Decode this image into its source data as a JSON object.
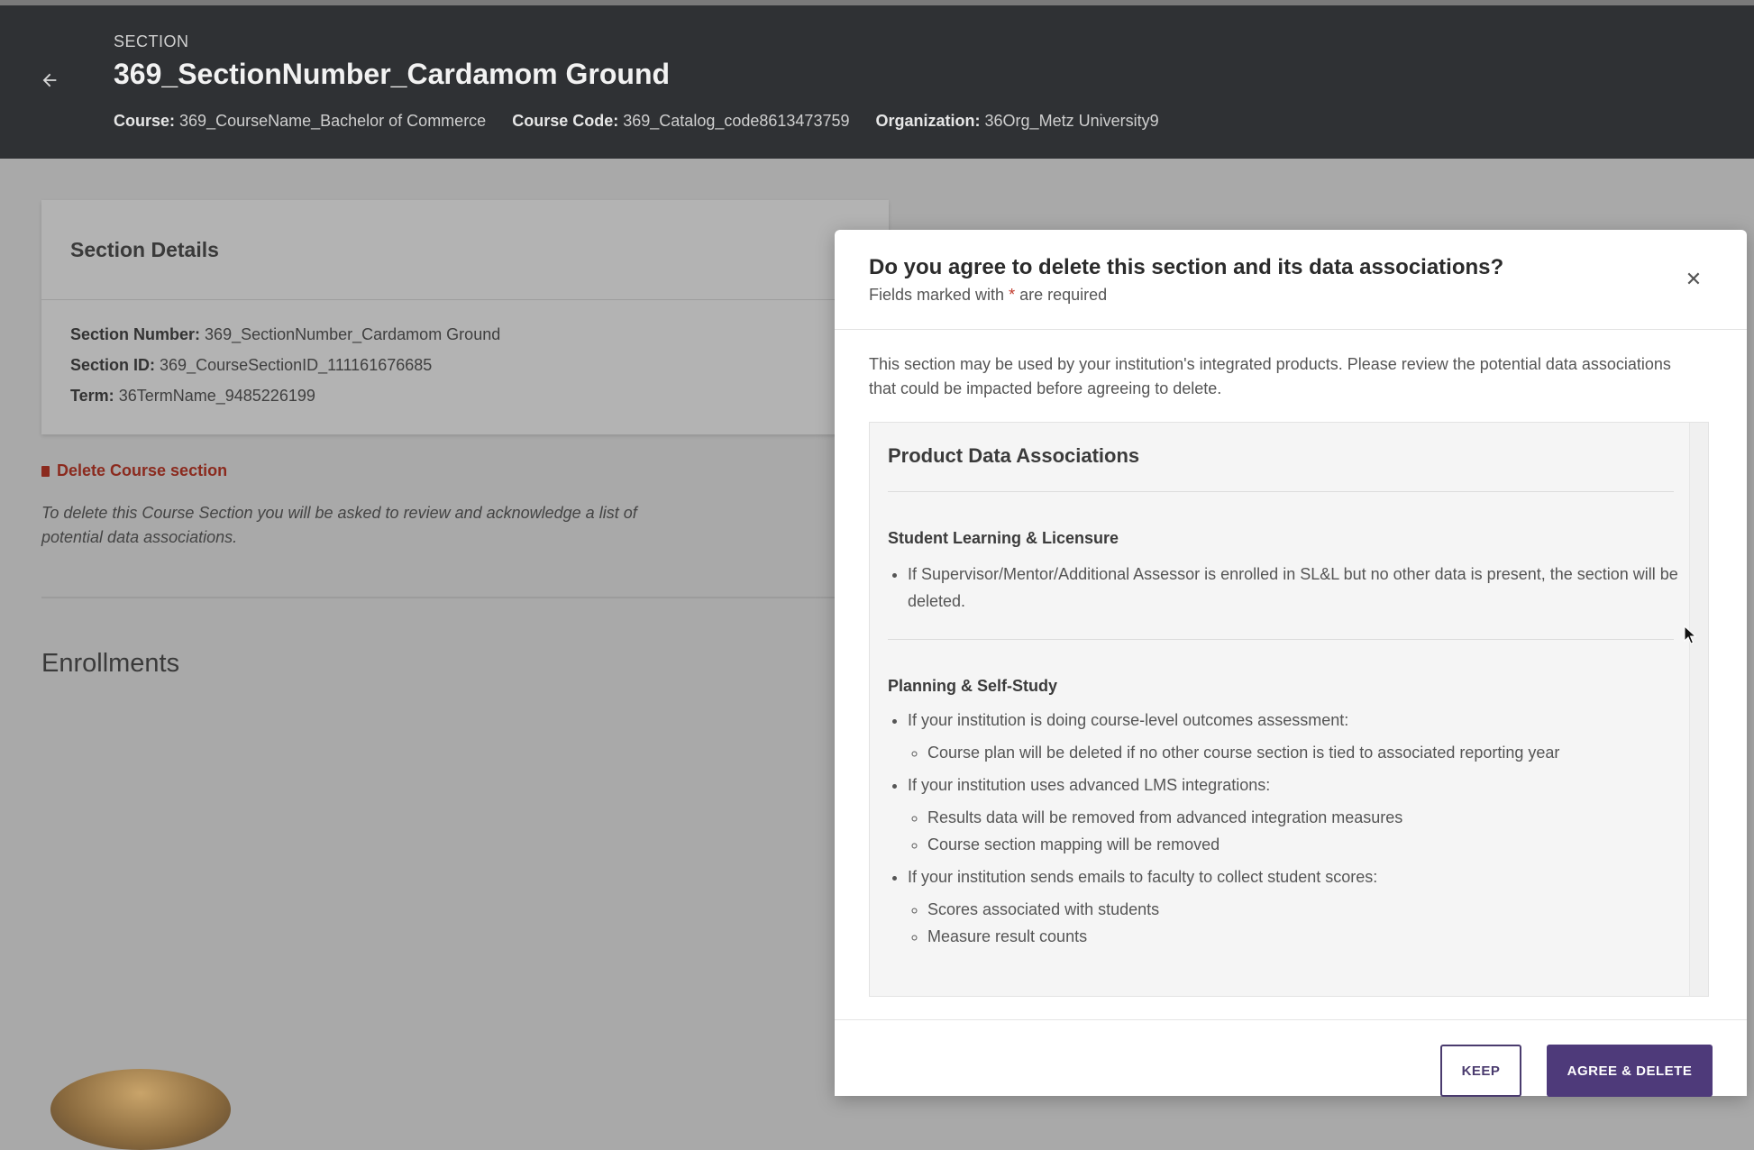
{
  "header": {
    "eyebrow": "SECTION",
    "title": "369_SectionNumber_Cardamom Ground",
    "meta": {
      "course_label": "Course:",
      "course_value": "369_CourseName_Bachelor of Commerce",
      "code_label": "Course Code:",
      "code_value": "369_Catalog_code8613473759",
      "org_label": "Organization:",
      "org_value": "36Org_Metz University9"
    }
  },
  "section_details": {
    "title": "Section Details",
    "number_label": "Section Number:",
    "number_value": "369_SectionNumber_Cardamom Ground",
    "id_label": "Section ID:",
    "id_value": "369_CourseSectionID_111161676685",
    "term_label": "Term:",
    "term_value": "36TermName_9485226199"
  },
  "delete_section": {
    "link_label": "Delete Course section",
    "help_text": "To delete this Course Section you will be asked to review and acknowledge a list of potential data associations."
  },
  "enrollments": {
    "title": "Enrollments"
  },
  "modal": {
    "title": "Do you agree to delete this section and its data associations?",
    "subtitle_pre": "Fields marked with ",
    "subtitle_req": "*",
    "subtitle_post": " are required",
    "intro": "This section may be used by your institution's integrated products. Please review the potential data associations that could be impacted before agreeing to delete.",
    "associations": {
      "title": "Product Data Associations",
      "sl_title": "Student Learning & Licensure",
      "sl_item": "If Supervisor/Mentor/Additional Assessor is enrolled in SL&L but no other data is present, the section will be deleted.",
      "ps_title": "Planning & Self-Study",
      "ps_item1": "If your institution is doing course-level outcomes assessment:",
      "ps_item1_sub1": "Course plan will be deleted if no other course section is tied to associated reporting year",
      "ps_item2": "If your institution uses advanced LMS integrations:",
      "ps_item2_sub1": "Results data will be removed from advanced integration measures",
      "ps_item2_sub2": "Course section mapping will be removed",
      "ps_item3": "If your institution sends emails to faculty to collect student scores:",
      "ps_item3_sub1": "Scores associated with students",
      "ps_item3_sub2": "Measure result counts"
    },
    "keep_label": "KEEP",
    "agree_label": "AGREE & DELETE",
    "close_icon": "close-icon"
  }
}
